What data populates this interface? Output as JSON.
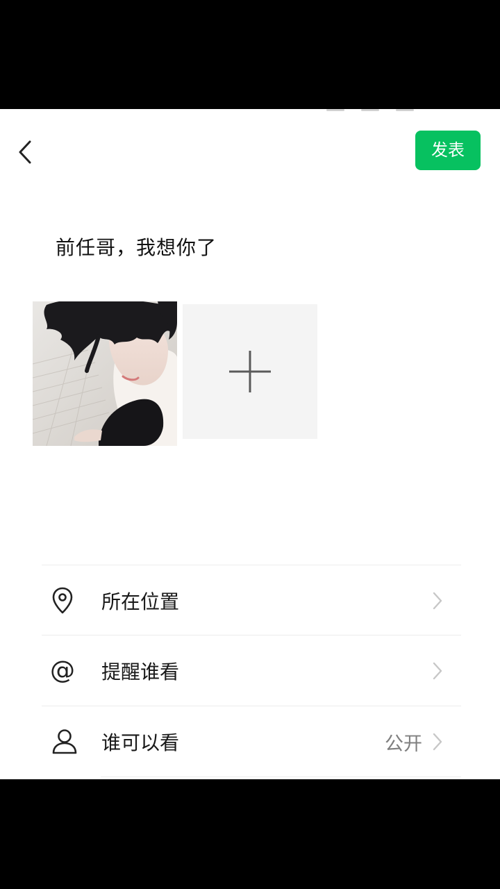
{
  "header": {
    "back_icon": "chevron-left-icon",
    "publish_label": "发表"
  },
  "post": {
    "text": "前任哥，我想你了",
    "photos": [
      "photo-of-person"
    ],
    "add_photo_icon": "plus-icon"
  },
  "options": [
    {
      "icon": "location-pin-icon",
      "label": "所在位置",
      "value": ""
    },
    {
      "icon": "at-icon",
      "label": "提醒谁看",
      "value": ""
    },
    {
      "icon": "person-icon",
      "label": "谁可以看",
      "value": "公开"
    }
  ],
  "colors": {
    "accent": "#07c160",
    "background": "#ffffff",
    "chevron": "#c7c7c7",
    "secondary_text": "#7f7f7f"
  }
}
